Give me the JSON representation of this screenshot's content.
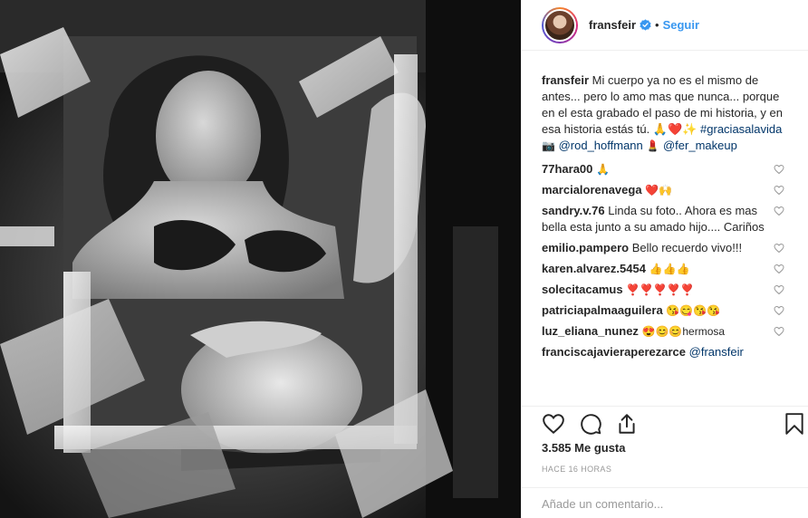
{
  "post": {
    "username": "fransfeir",
    "dot": "•",
    "follow_label": "Seguir"
  },
  "caption": {
    "user": "fransfeir",
    "text": "Mi cuerpo ya no es el mismo de antes... pero lo amo mas que nunca... porque en el esta grabado el paso de mi historia, y en esa historia estás tú. 🙏❤️✨",
    "hashtag": "#graciasalavida",
    "camera": "📷",
    "mention1": "@rod_hoffmann",
    "emoji_after": "💄",
    "mention2": "@fer_makeup"
  },
  "comments": [
    {
      "user": "77hara00",
      "text": "🙏"
    },
    {
      "user": "marcialorenavega",
      "text": "❤️🙌"
    },
    {
      "user": "sandry.v.76",
      "text": "Linda su foto.. Ahora es mas bella esta junto a su amado hijo.... Cariños"
    },
    {
      "user": "emilio.pampero",
      "text": "Bello recuerdo vivo!!!"
    },
    {
      "user": "karen.alvarez.5454",
      "text": "👍👍👍"
    },
    {
      "user": "solecitacamus",
      "text": "❣️❣️❣️❣️❣️"
    },
    {
      "user": "patriciapalmaaguilera",
      "text": "😘😋😘😘"
    },
    {
      "user": "luz_eliana_nunez",
      "text": "😍😊😊hermosa"
    },
    {
      "user": "franciscajavieraperezarce",
      "mention": "@fransfeir"
    }
  ],
  "likes": "3.585 Me gusta",
  "time": "HACE 16 HORAS",
  "add_comment_placeholder": "Añade un comentario...",
  "icons": [
    "heart-icon",
    "comment-icon",
    "share-icon",
    "bookmark-icon",
    "verified-icon"
  ],
  "colors": {
    "link": "#3897f0",
    "mention": "#003569",
    "muted": "#999999",
    "verified": "#3897f0"
  }
}
